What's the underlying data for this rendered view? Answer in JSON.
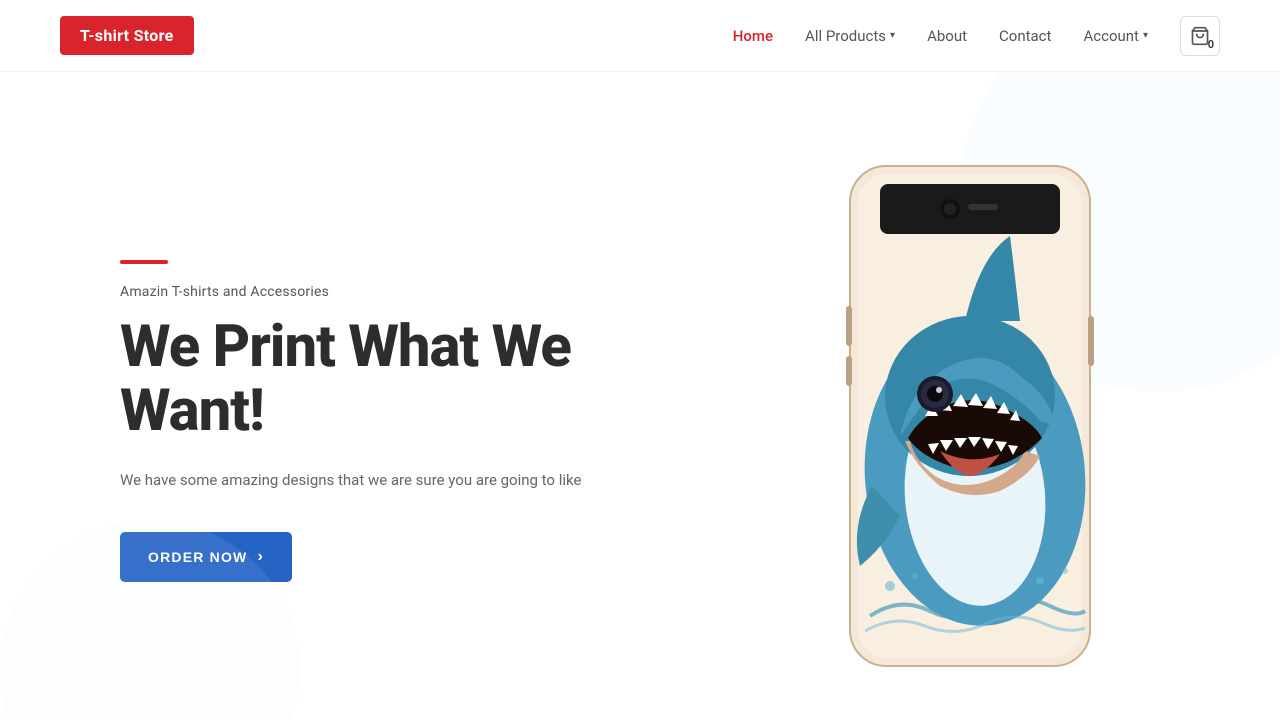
{
  "logo": {
    "text": "T-shirt Store"
  },
  "nav": {
    "home_label": "Home",
    "products_label": "All Products",
    "about_label": "About",
    "contact_label": "Contact",
    "account_label": "Account",
    "cart_count": "0"
  },
  "hero": {
    "subtitle": "Amazin T-shirts and Accessories",
    "title_line1": "We Print What We",
    "title_line2": "Want!",
    "description": "We have some amazing designs that we are sure you are going to like",
    "order_btn_label": "ORDER NOW"
  },
  "colors": {
    "red": "#d9232d",
    "blue": "#2563c4",
    "dark": "#2d2d2d",
    "gray": "#666"
  }
}
